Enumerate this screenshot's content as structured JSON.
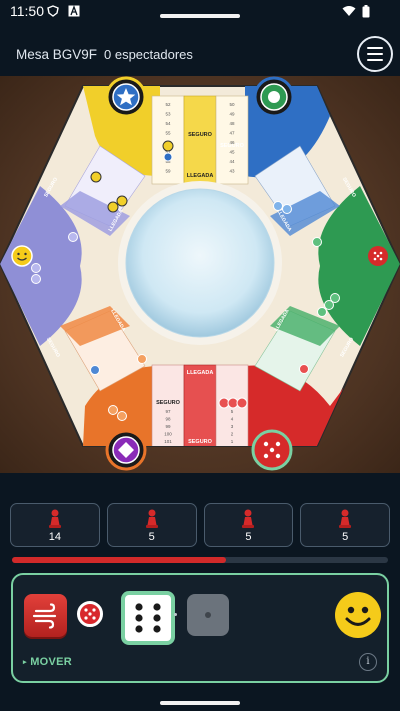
{
  "status_bar": {
    "time": "11:50",
    "icons": [
      "shield-icon",
      "text-a-icon",
      "wifi-icon",
      "battery-icon"
    ]
  },
  "header": {
    "table_name": "Mesa BGV9F",
    "spectators": "0 espectadores",
    "menu_icon": "hamburger-menu-icon"
  },
  "board": {
    "labels": {
      "safe": "SEGURO",
      "arrival": "LLEGADA"
    },
    "yellow_track_numbers": [
      "52",
      "53",
      "54",
      "55",
      "56",
      "57",
      "58",
      "59"
    ],
    "yellow_track_numbers_right": [
      "50",
      "49",
      "48",
      "47",
      "46",
      "45",
      "44",
      "43"
    ],
    "red_track_numbers": [
      "97",
      "98",
      "99",
      "100",
      "101"
    ],
    "red_track_numbers_right": [
      "5",
      "4",
      "3",
      "2",
      "1"
    ],
    "player_badges": [
      {
        "color": "yellow",
        "icon": "star-icon"
      },
      {
        "color": "blue",
        "icon": "circle-icon"
      },
      {
        "color": "green",
        "icon": "dice-icon"
      },
      {
        "color": "red",
        "icon": "dice-icon"
      },
      {
        "color": "orange",
        "icon": "diamond-icon"
      },
      {
        "color": "purple",
        "icon": "smiley-icon"
      }
    ],
    "colors": {
      "yellow": "#f1cf2a",
      "blue": "#2f6fc4",
      "green": "#2e9a52",
      "red": "#d62a2a",
      "orange": "#e8742a",
      "purple": "#8f8fd6"
    }
  },
  "counters": [
    {
      "icon": "red-pawn-icon",
      "value": "14"
    },
    {
      "icon": "red-pawn-icon",
      "value": "5"
    },
    {
      "icon": "red-pawn-icon",
      "value": "5"
    },
    {
      "icon": "red-pawn-icon",
      "value": "5"
    }
  ],
  "turn_timer": {
    "progress": 0.57,
    "color": "#d12a2a"
  },
  "controls": {
    "wind_icon": "wind-icon",
    "mini_die_icon": "dice-icon",
    "die_value": 6,
    "empty_die_icon": "dice-empty-icon",
    "emoji_icon": "smiley-icon",
    "action_label": "MOVER",
    "info_label": "i"
  }
}
